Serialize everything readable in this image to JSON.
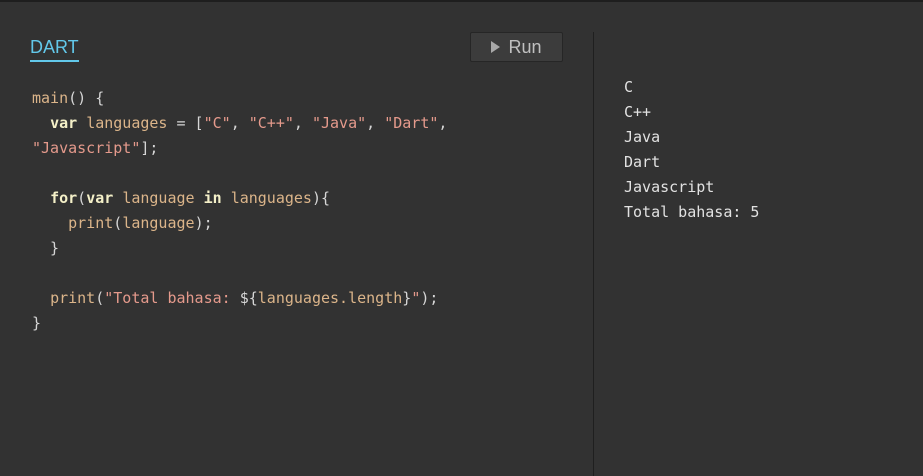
{
  "editor": {
    "tab_label": "DART",
    "run_label": "Run",
    "code_lines": [
      [
        {
          "t": "main",
          "c": "id"
        },
        {
          "t": "() {",
          "c": "plain"
        }
      ],
      [
        {
          "t": "  ",
          "c": "plain"
        },
        {
          "t": "var",
          "c": "kw"
        },
        {
          "t": " ",
          "c": "plain"
        },
        {
          "t": "languages",
          "c": "id"
        },
        {
          "t": " = [",
          "c": "plain"
        },
        {
          "t": "\"C\"",
          "c": "str"
        },
        {
          "t": ", ",
          "c": "plain"
        },
        {
          "t": "\"C++\"",
          "c": "str"
        },
        {
          "t": ", ",
          "c": "plain"
        },
        {
          "t": "\"Java\"",
          "c": "str"
        },
        {
          "t": ", ",
          "c": "plain"
        },
        {
          "t": "\"Dart\"",
          "c": "str"
        },
        {
          "t": ",",
          "c": "plain"
        }
      ],
      [
        {
          "t": "\"Javascript\"",
          "c": "str"
        },
        {
          "t": "];",
          "c": "plain"
        }
      ],
      [],
      [
        {
          "t": "  ",
          "c": "plain"
        },
        {
          "t": "for",
          "c": "kw"
        },
        {
          "t": "(",
          "c": "plain"
        },
        {
          "t": "var",
          "c": "kw"
        },
        {
          "t": " ",
          "c": "plain"
        },
        {
          "t": "language",
          "c": "id"
        },
        {
          "t": " ",
          "c": "plain"
        },
        {
          "t": "in",
          "c": "kw"
        },
        {
          "t": " ",
          "c": "plain"
        },
        {
          "t": "languages",
          "c": "id"
        },
        {
          "t": "){",
          "c": "plain"
        }
      ],
      [
        {
          "t": "    ",
          "c": "plain"
        },
        {
          "t": "print",
          "c": "id"
        },
        {
          "t": "(",
          "c": "plain"
        },
        {
          "t": "language",
          "c": "id"
        },
        {
          "t": ");",
          "c": "plain"
        }
      ],
      [
        {
          "t": "  }",
          "c": "plain"
        }
      ],
      [],
      [
        {
          "t": "  ",
          "c": "plain"
        },
        {
          "t": "print",
          "c": "id"
        },
        {
          "t": "(",
          "c": "plain"
        },
        {
          "t": "\"Total bahasa: ",
          "c": "str"
        },
        {
          "t": "${",
          "c": "plain"
        },
        {
          "t": "languages.length",
          "c": "id"
        },
        {
          "t": "}",
          "c": "plain"
        },
        {
          "t": "\"",
          "c": "str"
        },
        {
          "t": ");",
          "c": "plain"
        }
      ],
      [
        {
          "t": "}",
          "c": "plain"
        }
      ]
    ]
  },
  "console": {
    "lines": [
      "C",
      "C++",
      "Java",
      "Dart",
      "Javascript",
      "Total bahasa: 5"
    ]
  }
}
